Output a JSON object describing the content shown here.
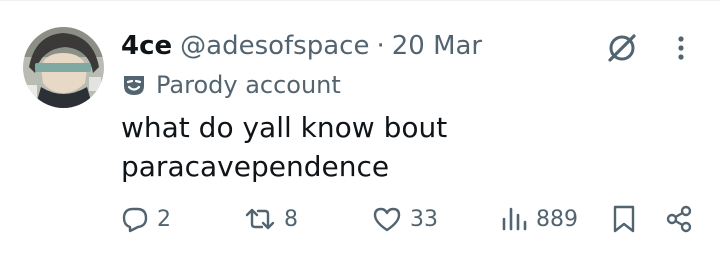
{
  "tweet": {
    "display_name": "4ce",
    "handle": "@adesofspace",
    "separator": "·",
    "timestamp": "20 Mar",
    "account_label": "Parody account",
    "text": "what do yall know bout paracavependence"
  },
  "actions": {
    "replies": "2",
    "reposts": "8",
    "likes": "33",
    "views": "889"
  },
  "colors": {
    "text_primary": "#0f1419",
    "text_secondary": "#536471",
    "divider": "#eff3f4"
  },
  "icons": [
    "grok-icon",
    "more-icon",
    "parody-mask-icon",
    "reply-icon",
    "repost-icon",
    "like-icon",
    "views-icon",
    "bookmark-icon",
    "share-icon"
  ]
}
